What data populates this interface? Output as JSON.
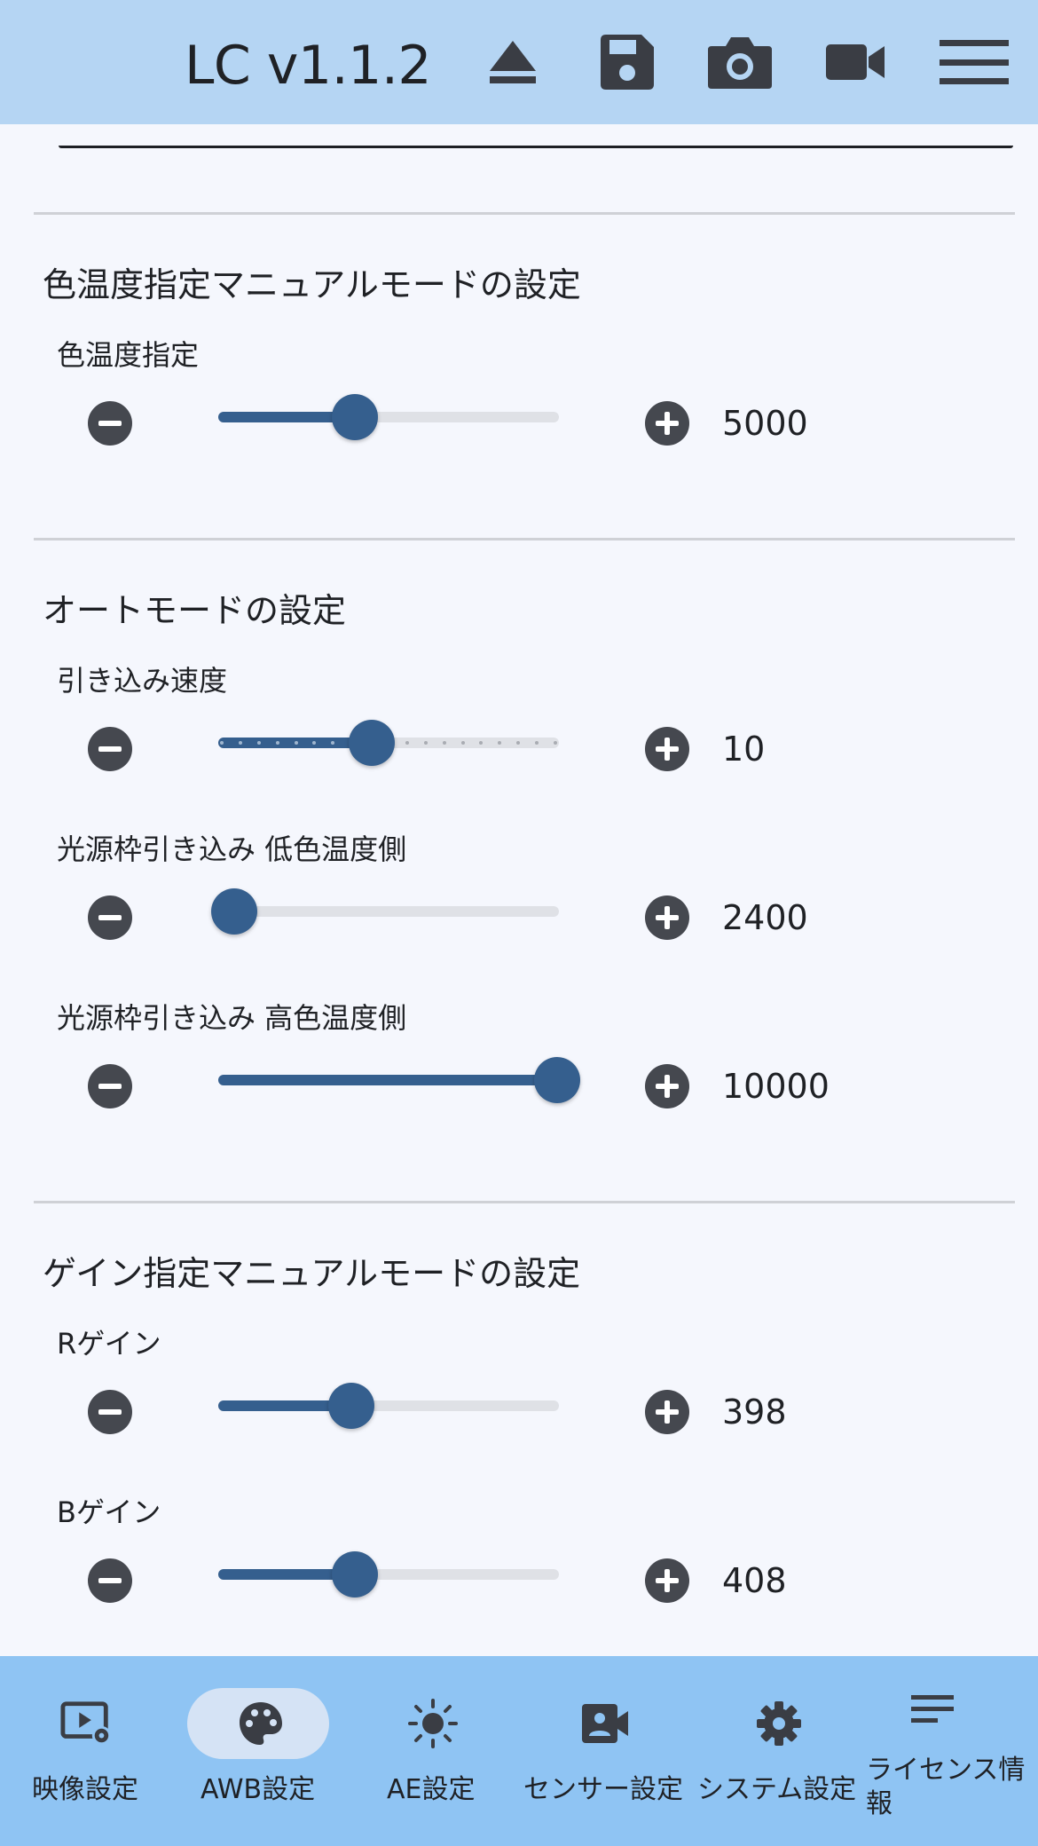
{
  "header": {
    "title": "LC v1.1.2",
    "icons": [
      "eject-icon",
      "save-icon",
      "camera-icon",
      "video-camera-icon",
      "menu-icon"
    ],
    "bg_color": "#b5d5f3"
  },
  "sections": [
    {
      "title": "色温度指定マニュアルモードの設定",
      "sliders": [
        {
          "label": "色温度指定",
          "value": "5000",
          "fraction": 0.4,
          "ticks": false
        }
      ]
    },
    {
      "title": "オートモードの設定",
      "sliders": [
        {
          "label": "引き込み速度",
          "value": "10",
          "fraction": 0.45,
          "ticks": true
        },
        {
          "label": "光源枠引き込み 低色温度側",
          "value": "2400",
          "fraction": 0.0,
          "ticks": false
        },
        {
          "label": "光源枠引き込み 高色温度側",
          "value": "10000",
          "fraction": 1.0,
          "ticks": false
        }
      ]
    },
    {
      "title": "ゲイン指定マニュアルモードの設定",
      "sliders": [
        {
          "label": "Rゲイン",
          "value": "398",
          "fraction": 0.39,
          "ticks": false
        },
        {
          "label": "Bゲイン",
          "value": "408",
          "fraction": 0.4,
          "ticks": false
        }
      ]
    }
  ],
  "bottom_nav": {
    "items": [
      {
        "label": "映像設定",
        "icon": "video-settings-icon",
        "active": false
      },
      {
        "label": "AWB設定",
        "icon": "palette-icon",
        "active": true
      },
      {
        "label": "AE設定",
        "icon": "brightness-icon",
        "active": false
      },
      {
        "label": "センサー設定",
        "icon": "camera-sensor-icon",
        "active": false
      },
      {
        "label": "システム設定",
        "icon": "gear-icon",
        "active": false
      },
      {
        "label": "ライセンス情報",
        "icon": "notes-icon",
        "active": false
      }
    ]
  },
  "colors": {
    "accent": "#355f8e",
    "track": "#dfe1e6",
    "button": "#45484f",
    "nav_bg": "#8fc4f3",
    "nav_active": "#d5e3f5",
    "page_bg": "#f5f7fd"
  }
}
